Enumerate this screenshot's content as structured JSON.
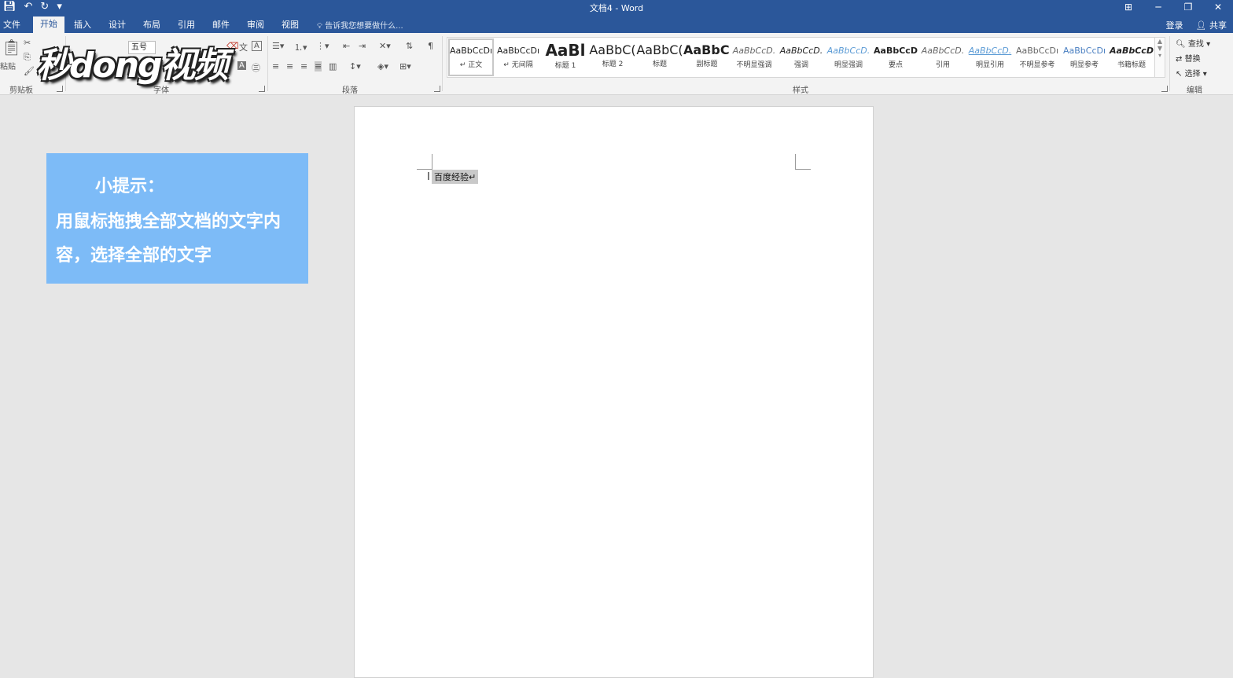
{
  "app": {
    "title": "文档4 - Word"
  },
  "window_buttons": [
    "⊞",
    "─",
    "❐",
    "✕"
  ],
  "tabs": [
    "文件",
    "开始",
    "插入",
    "设计",
    "布局",
    "引用",
    "邮件",
    "审阅",
    "视图"
  ],
  "tell_me": "告诉我您想要做什么...",
  "account": {
    "login": "登录",
    "share": "共享"
  },
  "ribbon": {
    "font_size": "五号",
    "groups": {
      "clipboard": "剪贴板",
      "font": "字体",
      "paragraph": "段落",
      "styles": "样式",
      "editing": "编辑"
    },
    "clipboard": {
      "paste": "粘贴"
    },
    "styles": [
      {
        "sample": "AaBbCcDı",
        "label": "↵ 正文"
      },
      {
        "sample": "AaBbCcDı",
        "label": "↵ 无间隔"
      },
      {
        "sample": "AaBl",
        "label": "标题 1"
      },
      {
        "sample": "AaBbC(",
        "label": "标题 2"
      },
      {
        "sample": "AaBbC(",
        "label": "标题"
      },
      {
        "sample": "AaBbC(",
        "label": "副标题"
      },
      {
        "sample": "AaBbCcD.",
        "label": "不明显强调"
      },
      {
        "sample": "AaBbCcD.",
        "label": "强调"
      },
      {
        "sample": "AaBbCcD.",
        "label": "明显强调"
      },
      {
        "sample": "AaBbCcD",
        "label": "要点"
      },
      {
        "sample": "AaBbCcD.",
        "label": "引用"
      },
      {
        "sample": "AaBbCcD.",
        "label": "明显引用"
      },
      {
        "sample": "AaBbCcDı",
        "label": "不明显参考"
      },
      {
        "sample": "AaBbCcDı",
        "label": "明显参考"
      },
      {
        "sample": "AaBbCcD",
        "label": "书籍标题"
      }
    ],
    "editing": {
      "find": "查找",
      "replace": "替换",
      "select": "选择"
    }
  },
  "watermark": "秒dong视频",
  "tip": {
    "title": "小提示：",
    "body": "用鼠标拖拽全部文档的文字内容，选择全部的文字"
  },
  "document": {
    "text": "百度经验↵"
  }
}
